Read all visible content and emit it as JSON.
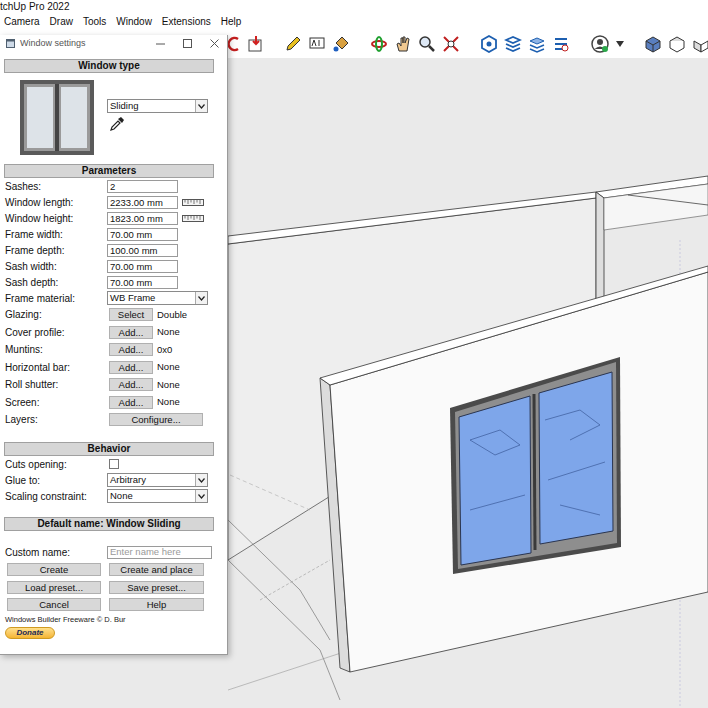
{
  "app": {
    "title": "tchUp Pro 2022",
    "menu": [
      "Camera",
      "Draw",
      "Tools",
      "Window",
      "Extensions",
      "Help"
    ]
  },
  "dialog": {
    "title": "Window settings",
    "window_type": {
      "header": "Window type",
      "value": "Sliding"
    },
    "parameters": {
      "header": "Parameters",
      "rows": [
        {
          "kind": "field",
          "label": "Sashes:",
          "value": "2"
        },
        {
          "kind": "measure",
          "label": "Window length:",
          "value": "2233.00 mm"
        },
        {
          "kind": "measure",
          "label": "Window height:",
          "value": "1823.00 mm"
        },
        {
          "kind": "field",
          "label": "Frame width:",
          "value": "70.00 mm"
        },
        {
          "kind": "field",
          "label": "Frame depth:",
          "value": "100.00 mm"
        },
        {
          "kind": "field",
          "label": "Sash width:",
          "value": "70.00 mm"
        },
        {
          "kind": "field",
          "label": "Sash depth:",
          "value": "70.00 mm"
        },
        {
          "kind": "select",
          "label": "Frame material:",
          "value": "WB Frame"
        },
        {
          "kind": "button",
          "label": "Glazing:",
          "button": "Select",
          "value": "Double"
        },
        {
          "kind": "button",
          "label": "Cover profile:",
          "button": "Add...",
          "value": "None"
        },
        {
          "kind": "button",
          "label": "Muntins:",
          "button": "Add...",
          "value": "0x0"
        },
        {
          "kind": "button",
          "label": "Horizontal bar:",
          "button": "Add...",
          "value": "None"
        },
        {
          "kind": "button",
          "label": "Roll shutter:",
          "button": "Add...",
          "value": "None"
        },
        {
          "kind": "button",
          "label": "Screen:",
          "button": "Add...",
          "value": "None"
        },
        {
          "kind": "wide",
          "label": "Layers:",
          "button": "Configure..."
        }
      ]
    },
    "behavior": {
      "header": "Behavior",
      "rows": [
        {
          "kind": "checkbox",
          "label": "Cuts opening:",
          "checked": false
        },
        {
          "kind": "select",
          "label": "Glue to:",
          "value": "Arbitrary"
        },
        {
          "kind": "select",
          "label": "Scaling constraint:",
          "value": "None"
        }
      ]
    },
    "default_name": "Default name: Window Sliding",
    "custom_name": {
      "label": "Custom name:",
      "placeholder": "Enter name here"
    },
    "buttons": [
      "Create",
      "Create and place",
      "Load preset...",
      "Save preset...",
      "Cancel",
      "Help"
    ],
    "footer": "Windows Builder Freeware © D. Bur",
    "donate": "Donate"
  }
}
